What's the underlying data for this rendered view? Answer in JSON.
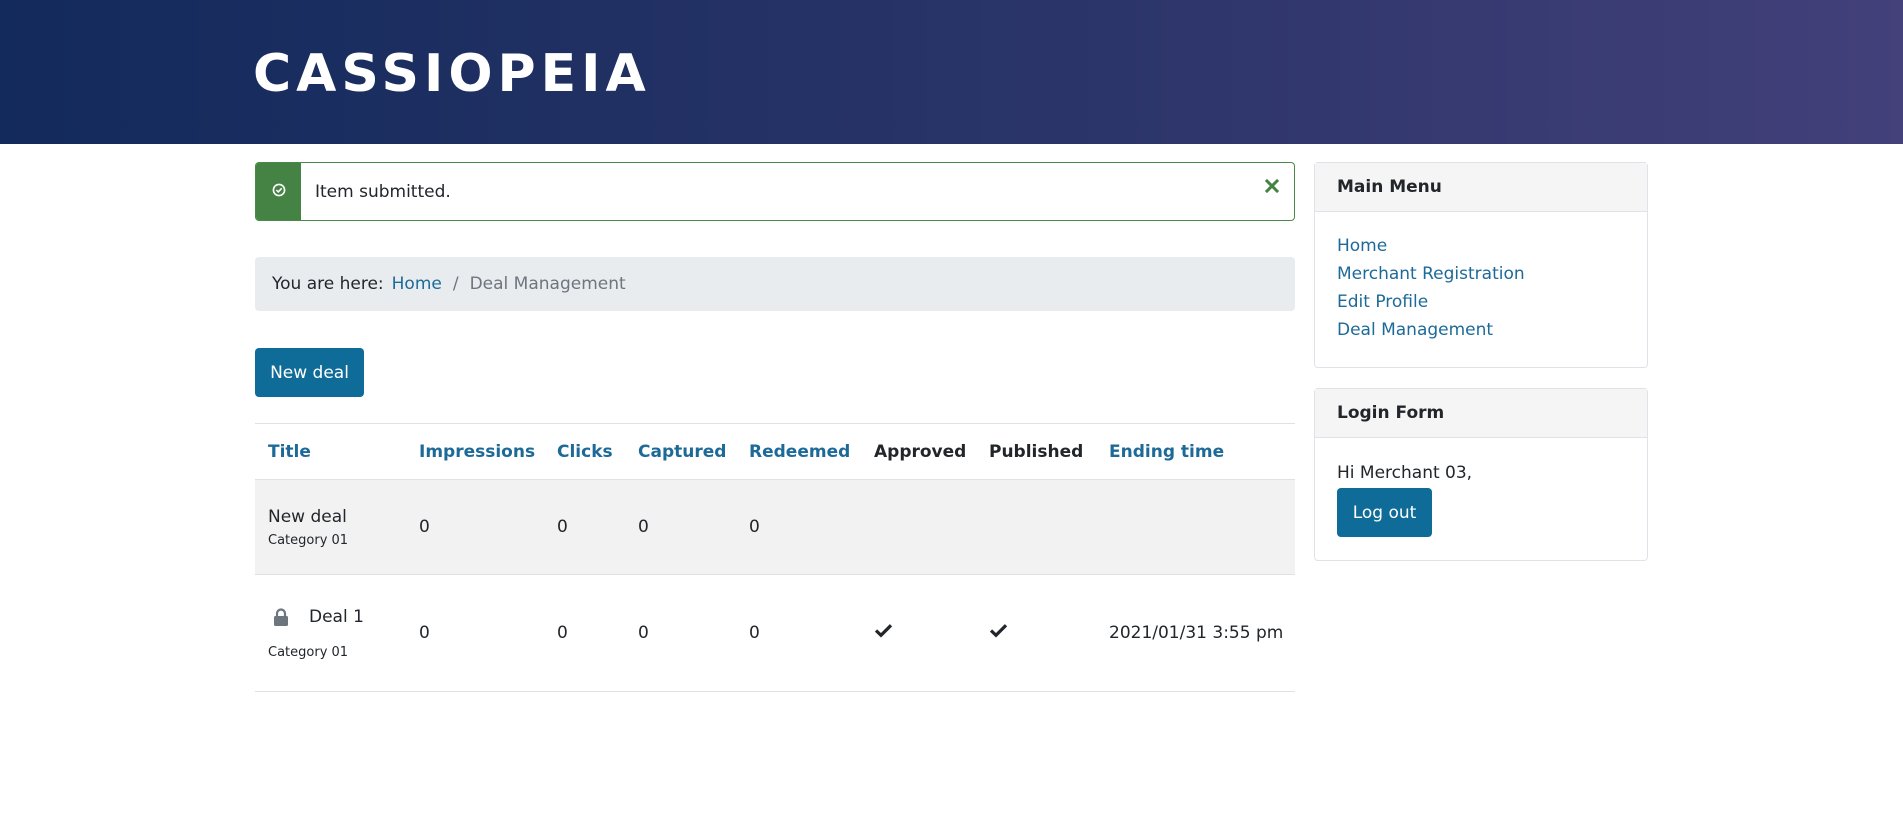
{
  "site": {
    "brand": "CASSIOPEIA"
  },
  "alert": {
    "message": "Item submitted.",
    "icon": "check-circle-icon",
    "close_icon": "close-icon",
    "color": "#448344"
  },
  "breadcrumb": {
    "label": "You are here:",
    "home": "Home",
    "separator": "/",
    "current": "Deal Management"
  },
  "actions": {
    "new_deal": "New deal"
  },
  "table": {
    "columns": [
      "Title",
      "Impressions",
      "Clicks",
      "Captured",
      "Redeemed",
      "Approved",
      "Published",
      "Ending time"
    ],
    "rows": [
      {
        "title": "New deal",
        "category": "Category 01",
        "impressions": "0",
        "clicks": "0",
        "captured": "0",
        "redeemed": "0",
        "approved": "",
        "published": "",
        "ending_time": ""
      },
      {
        "title": "Deal 1",
        "category": "Category 01",
        "locked": true,
        "impressions": "0",
        "clicks": "0",
        "captured": "0",
        "redeemed": "0",
        "approved": "check",
        "published": "check",
        "ending_time": "2021/01/31 3:55 pm"
      }
    ]
  },
  "sidebar": {
    "main_menu": {
      "title": "Main Menu",
      "items": [
        {
          "label": "Home"
        },
        {
          "label": "Merchant Registration"
        },
        {
          "label": "Edit Profile"
        },
        {
          "label": "Deal Management"
        }
      ]
    },
    "login_form": {
      "title": "Login Form",
      "greeting": "Hi Merchant 03,",
      "logout": "Log out"
    }
  },
  "colors": {
    "accent": "#0f6b97",
    "link": "#1d6a98",
    "success": "#448344",
    "header_start": "#132a5c",
    "header_end": "#43407a"
  }
}
